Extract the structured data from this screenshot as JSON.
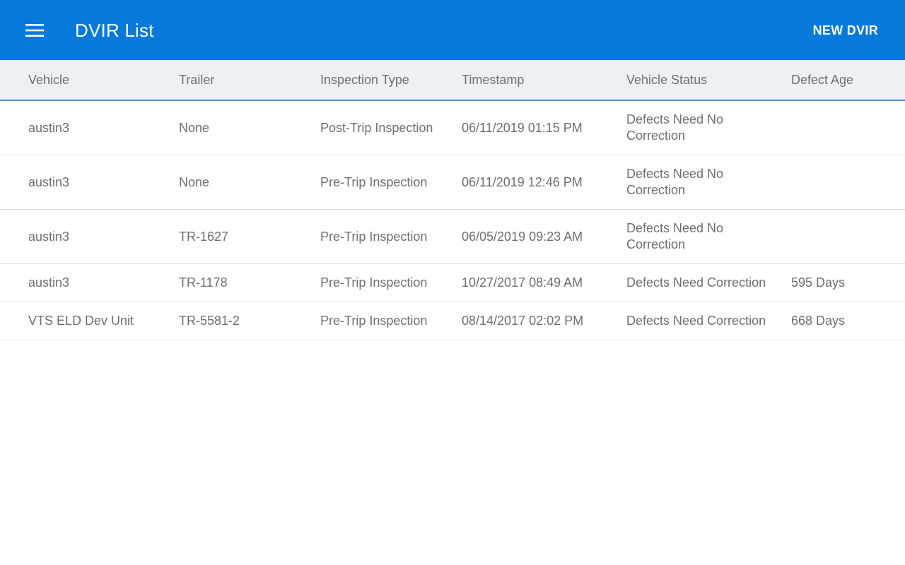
{
  "appbar": {
    "title": "DVIR List",
    "new_label": "NEW DVIR",
    "color": "#0679DA"
  },
  "table": {
    "columns": [
      "Vehicle",
      "Trailer",
      "Inspection Type",
      "Timestamp",
      "Vehicle Status",
      "Defect Age"
    ],
    "rows": [
      {
        "vehicle": "austin3",
        "trailer": "None",
        "inspection_type": "Post-Trip Inspection",
        "timestamp": "06/11/2019 01:15 PM",
        "status": "Defects Need No Correction",
        "defect_age": ""
      },
      {
        "vehicle": "austin3",
        "trailer": "None",
        "inspection_type": "Pre-Trip Inspection",
        "timestamp": "06/11/2019 12:46 PM",
        "status": "Defects Need No Correction",
        "defect_age": ""
      },
      {
        "vehicle": "austin3",
        "trailer": "TR-1627",
        "inspection_type": "Pre-Trip Inspection",
        "timestamp": "06/05/2019 09:23 AM",
        "status": "Defects Need No Correction",
        "defect_age": ""
      },
      {
        "vehicle": "austin3",
        "trailer": "TR-1178",
        "inspection_type": "Pre-Trip Inspection",
        "timestamp": "10/27/2017 08:49 AM",
        "status": "Defects Need Correction",
        "defect_age": "595 Days"
      },
      {
        "vehicle": "VTS ELD Dev Unit",
        "trailer": "TR-5581-2",
        "inspection_type": "Pre-Trip Inspection",
        "timestamp": "08/14/2017 02:02 PM",
        "status": "Defects Need Correction",
        "defect_age": "668 Days"
      }
    ]
  }
}
